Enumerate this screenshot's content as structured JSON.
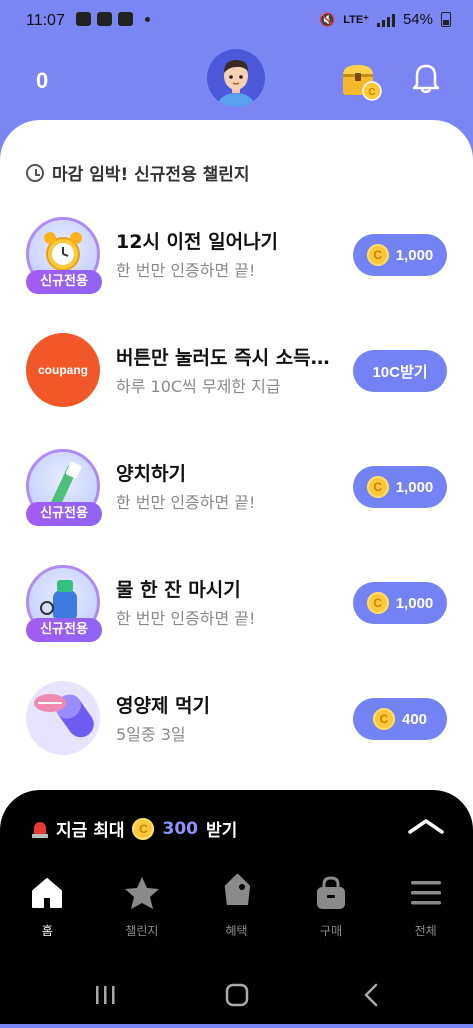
{
  "status_bar": {
    "time": "11:07",
    "network": "LTE⁺",
    "battery": "54%"
  },
  "header": {
    "coin_count": "0"
  },
  "section": {
    "title": "마감 임박! 신규전용 챌린지"
  },
  "challenges": [
    {
      "title": "12시 이전 일어나기",
      "subtitle": "한 번만 인증하면 끝!",
      "badge": "신규전용",
      "reward": "1,000",
      "icon": "alarm-clock-icon"
    },
    {
      "title": "버튼만 눌러도 즉시 소득 지급",
      "subtitle": "하루 10C씩 무제한 지급",
      "logo_text": "coupang",
      "reward": "10C받기",
      "icon": "coupang-logo"
    },
    {
      "title": "양치하기",
      "subtitle": "한 번만 인증하면 끝!",
      "badge": "신규전용",
      "reward": "1,000",
      "icon": "toothbrush-icon"
    },
    {
      "title": "물 한 잔 마시기",
      "subtitle": "한 번만 인증하면 끝!",
      "badge": "신규전용",
      "reward": "1,000",
      "icon": "water-bottle-icon"
    },
    {
      "title": "영양제 먹기",
      "subtitle": "5일중 3일",
      "reward": "400",
      "icon": "pill-icon"
    }
  ],
  "coin_symbol": "C",
  "promo": {
    "prefix": "지금 최대",
    "amount": "300",
    "suffix": "받기"
  },
  "nav": [
    {
      "label": "홈",
      "icon": "home-icon"
    },
    {
      "label": "챌린지",
      "icon": "star-icon"
    },
    {
      "label": "혜택",
      "icon": "tag-icon"
    },
    {
      "label": "구매",
      "icon": "shopping-bag-icon"
    },
    {
      "label": "전체",
      "icon": "menu-icon"
    }
  ],
  "colors": {
    "accent": "#7b86f4",
    "reward_button": "#7382f5",
    "coin": "#ffc83a",
    "badge": "#9b5ff2"
  }
}
